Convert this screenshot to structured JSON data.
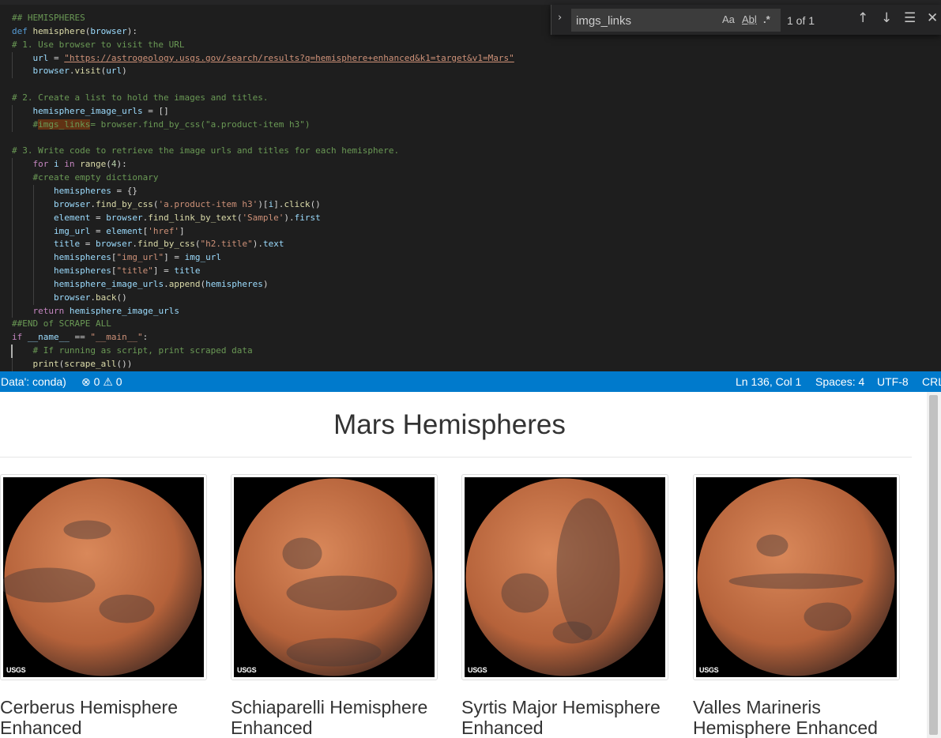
{
  "editor": {
    "lines": [
      [
        [
          "tk-c",
          "## HEMISPHERES"
        ]
      ],
      [
        [
          "tk-kb",
          "def"
        ],
        [
          "",
          " "
        ],
        [
          "tk-f",
          "hemisphere"
        ],
        [
          "",
          "("
        ],
        [
          "tk-v",
          "browser"
        ],
        [
          "",
          "):"
        ]
      ],
      [
        [
          "tk-c",
          "# 1. Use browser to visit the URL"
        ]
      ],
      [
        [
          "tk-v",
          "url"
        ],
        [
          "",
          " = "
        ],
        [
          "tk-s tk-link",
          "\"https://astrogeology.usgs.gov/search/results?q=hemisphere+enhanced&k1=target&v1=Mars\""
        ]
      ],
      [
        [
          "tk-v",
          "browser"
        ],
        [
          "",
          "."
        ],
        [
          "tk-f",
          "visit"
        ],
        [
          "",
          "("
        ],
        [
          "tk-v",
          "url"
        ],
        [
          "",
          ")"
        ]
      ],
      [],
      [
        [
          "tk-c",
          "# 2. Create a list to hold the images and titles."
        ]
      ],
      [
        [
          "tk-v",
          "hemisphere_image_urls"
        ],
        [
          "",
          " = []"
        ]
      ],
      [
        [
          "tk-c",
          "#"
        ],
        [
          "tk-hl",
          "imgs_links"
        ],
        [
          "tk-c",
          "= browser.find_by_css(\"a.product-item h3\")"
        ]
      ],
      [],
      [
        [
          "tk-c",
          "# 3. Write code to retrieve the image urls and titles for each hemisphere."
        ]
      ],
      [
        [
          "tk-k",
          "for"
        ],
        [
          "",
          " "
        ],
        [
          "tk-v",
          "i"
        ],
        [
          "",
          " "
        ],
        [
          "tk-k",
          "in"
        ],
        [
          "",
          " "
        ],
        [
          "tk-f",
          "range"
        ],
        [
          "",
          "("
        ],
        [
          "tk-n",
          "4"
        ],
        [
          "",
          "):"
        ]
      ],
      [
        [
          "tk-c",
          "#create empty dictionary"
        ]
      ],
      [
        [
          "tk-v",
          "hemispheres"
        ],
        [
          "",
          " = {}"
        ]
      ],
      [
        [
          "tk-v",
          "browser"
        ],
        [
          "",
          "."
        ],
        [
          "tk-f",
          "find_by_css"
        ],
        [
          "",
          "("
        ],
        [
          "tk-s",
          "'a.product-item h3'"
        ],
        [
          "",
          ")["
        ],
        [
          "tk-v",
          "i"
        ],
        [
          "",
          "]."
        ],
        [
          "tk-f",
          "click"
        ],
        [
          "",
          "()"
        ]
      ],
      [
        [
          "tk-v",
          "element"
        ],
        [
          "",
          " = "
        ],
        [
          "tk-v",
          "browser"
        ],
        [
          "",
          "."
        ],
        [
          "tk-f",
          "find_link_by_text"
        ],
        [
          "",
          "("
        ],
        [
          "tk-s",
          "'Sample'"
        ],
        [
          "",
          ")."
        ],
        [
          "tk-v",
          "first"
        ]
      ],
      [
        [
          "tk-v",
          "img_url"
        ],
        [
          "",
          " = "
        ],
        [
          "tk-v",
          "element"
        ],
        [
          "",
          "["
        ],
        [
          "tk-s",
          "'href'"
        ],
        [
          "",
          "]"
        ]
      ],
      [
        [
          "tk-v",
          "title"
        ],
        [
          "",
          " = "
        ],
        [
          "tk-v",
          "browser"
        ],
        [
          "",
          "."
        ],
        [
          "tk-f",
          "find_by_css"
        ],
        [
          "",
          "("
        ],
        [
          "tk-s",
          "\"h2.title\""
        ],
        [
          "",
          ")."
        ],
        [
          "tk-v",
          "text"
        ]
      ],
      [
        [
          "tk-v",
          "hemispheres"
        ],
        [
          "",
          "["
        ],
        [
          "tk-s",
          "\"img_url\""
        ],
        [
          "",
          "] = "
        ],
        [
          "tk-v",
          "img_url"
        ]
      ],
      [
        [
          "tk-v",
          "hemispheres"
        ],
        [
          "",
          "["
        ],
        [
          "tk-s",
          "\"title\""
        ],
        [
          "",
          "] = "
        ],
        [
          "tk-v",
          "title"
        ]
      ],
      [
        [
          "tk-v",
          "hemisphere_image_urls"
        ],
        [
          "",
          "."
        ],
        [
          "tk-f",
          "append"
        ],
        [
          "",
          "("
        ],
        [
          "tk-v",
          "hemispheres"
        ],
        [
          "",
          ")"
        ]
      ],
      [
        [
          "tk-v",
          "browser"
        ],
        [
          "",
          "."
        ],
        [
          "tk-f",
          "back"
        ],
        [
          "",
          "()"
        ]
      ],
      [
        [
          "tk-k",
          "return"
        ],
        [
          "",
          " "
        ],
        [
          "tk-v",
          "hemisphere_image_urls"
        ]
      ],
      [
        [
          "tk-c",
          "##END of SCRAPE ALL"
        ]
      ],
      [
        [
          "tk-k",
          "if"
        ],
        [
          "",
          " "
        ],
        [
          "tk-v",
          "__name__"
        ],
        [
          "",
          " == "
        ],
        [
          "tk-s",
          "\"__main__\""
        ],
        [
          "",
          ":"
        ]
      ],
      [
        [
          "tk-c",
          "# If running as script, print scraped data"
        ]
      ],
      [
        [
          "tk-f",
          "print"
        ],
        [
          "",
          "("
        ],
        [
          "tk-f",
          "scrape_all"
        ],
        [
          "",
          "())"
        ]
      ]
    ],
    "indents": [
      0,
      0,
      0,
      1,
      1,
      0,
      0,
      1,
      1,
      0,
      0,
      1,
      1,
      2,
      2,
      2,
      2,
      2,
      2,
      2,
      2,
      2,
      1,
      0,
      0,
      1,
      1
    ],
    "cursor_line": 25
  },
  "find": {
    "query": "imgs_links",
    "match_case": "Aa",
    "whole_word": "Ab̲l",
    "regex": ".*",
    "count": "1 of 1"
  },
  "statusbar": {
    "env": "Data': conda)",
    "errors": "0",
    "warnings": "0",
    "position": "Ln 136, Col 1",
    "spaces": "Spaces: 4",
    "encoding": "UTF-8",
    "eol": "CRL"
  },
  "webpage": {
    "title": "Mars Hemispheres",
    "image_logo": "USGS",
    "hemispheres": [
      {
        "title": "Cerberus Hemisphere Enhanced"
      },
      {
        "title": "Schiaparelli Hemisphere Enhanced"
      },
      {
        "title": "Syrtis Major Hemisphere Enhanced"
      },
      {
        "title": "Valles Marineris Hemisphere Enhanced"
      }
    ]
  },
  "colors": {
    "statusbar": "#007acc",
    "editor_bg": "#1e1e1e",
    "mars_light": "#d9885a",
    "mars_mid": "#b5623a",
    "mars_dark": "#5a3628"
  }
}
